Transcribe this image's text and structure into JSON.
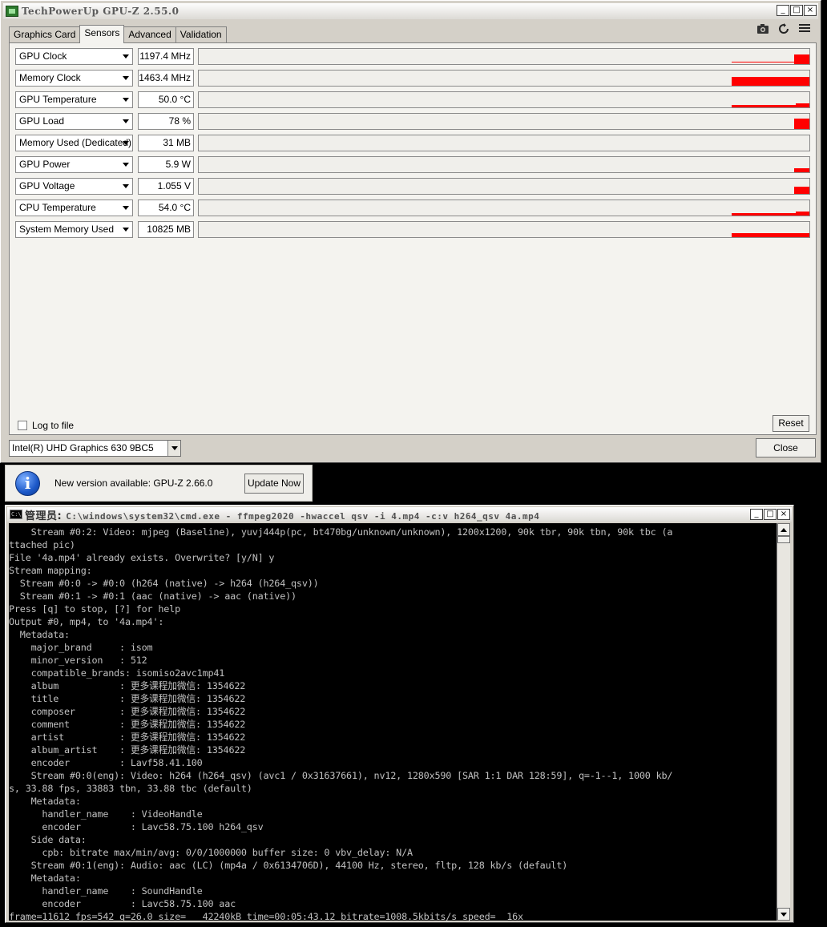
{
  "gpuz": {
    "title": "TechPowerUp GPU-Z 2.55.0",
    "window_controls": [
      "_",
      "□",
      "×"
    ],
    "tabs": [
      {
        "label": "Graphics Card",
        "active": false
      },
      {
        "label": "Sensors",
        "active": true
      },
      {
        "label": "Advanced",
        "active": false
      },
      {
        "label": "Validation",
        "active": false
      }
    ],
    "tool_icons": [
      "camera-icon",
      "refresh-icon",
      "menu-icon"
    ],
    "sensors": [
      {
        "name": "GPU Clock",
        "value": "1197.4 MHz",
        "graph": "spike_line"
      },
      {
        "name": "Memory Clock",
        "value": "1463.4 MHz",
        "graph": "full_block"
      },
      {
        "name": "GPU Temperature",
        "value": "50.0 °C",
        "graph": "low_line"
      },
      {
        "name": "GPU Load",
        "value": "78 %",
        "graph": "tall_end"
      },
      {
        "name": "Memory Used (Dedicated)",
        "value": "31 MB",
        "graph": "none"
      },
      {
        "name": "GPU Power",
        "value": "5.9 W",
        "graph": "small_end"
      },
      {
        "name": "GPU Voltage",
        "value": "1.055 V",
        "graph": "mid_end"
      },
      {
        "name": "CPU Temperature",
        "value": "54.0 °C",
        "graph": "low_line"
      },
      {
        "name": "System Memory Used",
        "value": "10825 MB",
        "graph": "thin_block"
      }
    ],
    "graph_color": "#ff0000",
    "log_to_file_label": "Log to file",
    "log_to_file_checked": false,
    "reset_label": "Reset",
    "gpu_select_value": "Intel(R) UHD Graphics 630 9BC5",
    "close_label": "Close"
  },
  "update": {
    "icon": "info-icon",
    "message": "New version available: GPU-Z 2.66.0",
    "button_label": "Update Now"
  },
  "cmd": {
    "title_prefix": "管理员: ",
    "title": "C:\\windows\\system32\\cmd.exe - ffmpeg2020  -hwaccel qsv -i 4.mp4 -c:v h264_qsv 4a.mp4",
    "window_controls": [
      "_",
      "□",
      "×"
    ],
    "lines": [
      "    Stream #0:2: Video: mjpeg (Baseline), yuvj444p(pc, bt470bg/unknown/unknown), 1200x1200, 90k tbr, 90k tbn, 90k tbc (a",
      "ttached pic)",
      "File '4a.mp4' already exists. Overwrite? [y/N] y",
      "Stream mapping:",
      "  Stream #0:0 -> #0:0 (h264 (native) -> h264 (h264_qsv))",
      "  Stream #0:1 -> #0:1 (aac (native) -> aac (native))",
      "Press [q] to stop, [?] for help",
      "Output #0, mp4, to '4a.mp4':",
      "  Metadata:",
      "    major_brand     : isom",
      "    minor_version   : 512",
      "    compatible_brands: isomiso2avc1mp41",
      "    album           : 更多课程加微信: 1354622",
      "    title           : 更多课程加微信: 1354622",
      "    composer        : 更多课程加微信: 1354622",
      "    comment         : 更多课程加微信: 1354622",
      "    artist          : 更多课程加微信: 1354622",
      "    album_artist    : 更多课程加微信: 1354622",
      "    encoder         : Lavf58.41.100",
      "    Stream #0:0(eng): Video: h264 (h264_qsv) (avc1 / 0x31637661), nv12, 1280x590 [SAR 1:1 DAR 128:59], q=-1--1, 1000 kb/",
      "s, 33.88 fps, 33883 tbn, 33.88 tbc (default)",
      "    Metadata:",
      "      handler_name    : VideoHandle",
      "      encoder         : Lavc58.75.100 h264_qsv",
      "    Side data:",
      "      cpb: bitrate max/min/avg: 0/0/1000000 buffer size: 0 vbv_delay: N/A",
      "    Stream #0:1(eng): Audio: aac (LC) (mp4a / 0x6134706D), 44100 Hz, stereo, fltp, 128 kb/s (default)",
      "    Metadata:",
      "      handler_name    : SoundHandle",
      "      encoder         : Lavc58.75.100 aac",
      "frame=11612 fps=542 q=26.0 size=   42240kB time=00:05:43.12 bitrate=1008.5kbits/s speed=  16x"
    ]
  }
}
